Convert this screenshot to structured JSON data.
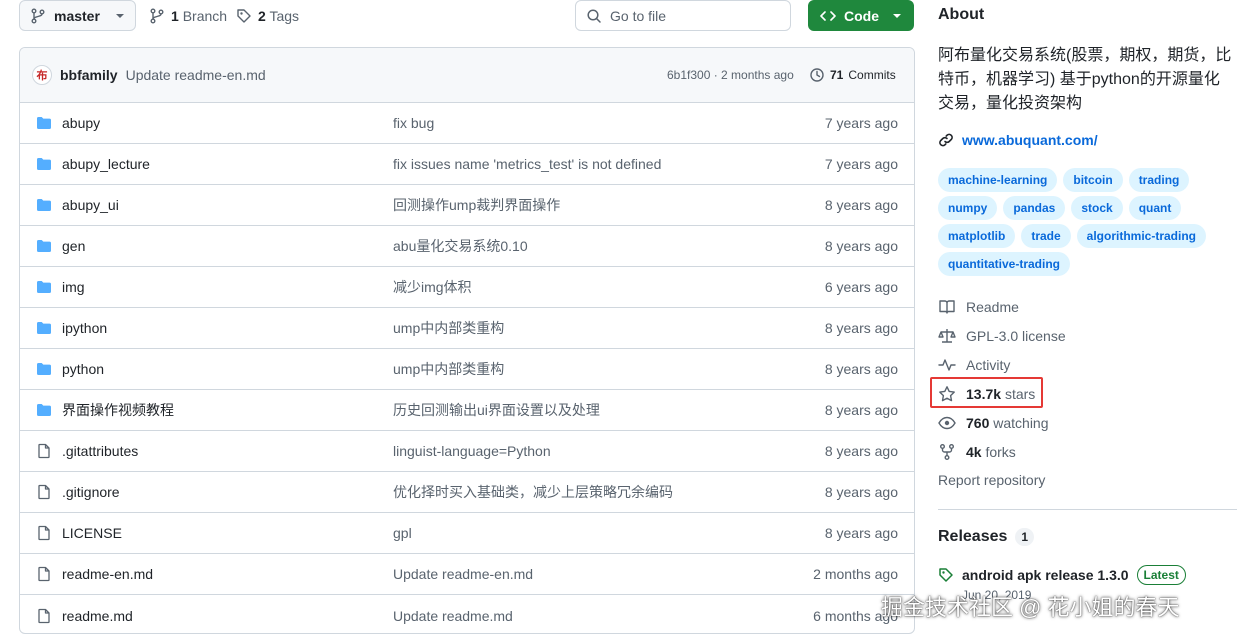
{
  "toolbar": {
    "branch": "master",
    "branches_count": "1",
    "branches_label": "Branch",
    "tags_count": "2",
    "tags_label": "Tags",
    "goto_placeholder": "Go to file",
    "code_label": "Code"
  },
  "latest_commit": {
    "avatar_text": "布",
    "author": "bbfamily",
    "message": "Update readme-en.md",
    "sha_time": "6b1f300 · 2 months ago",
    "commits_count": "71",
    "commits_label": "Commits"
  },
  "files": [
    {
      "type": "dir",
      "name": "abupy",
      "message": "fix bug",
      "date": "7 years ago"
    },
    {
      "type": "dir",
      "name": "abupy_lecture",
      "message": "fix issues name 'metrics_test' is not defined",
      "date": "7 years ago"
    },
    {
      "type": "dir",
      "name": "abupy_ui",
      "message": "回测操作ump裁判界面操作",
      "date": "8 years ago"
    },
    {
      "type": "dir",
      "name": "gen",
      "message": "abu量化交易系统0.10",
      "date": "8 years ago"
    },
    {
      "type": "dir",
      "name": "img",
      "message": "减少img体积",
      "date": "6 years ago"
    },
    {
      "type": "dir",
      "name": "ipython",
      "message": "ump中内部类重构",
      "date": "8 years ago"
    },
    {
      "type": "dir",
      "name": "python",
      "message": "ump中内部类重构",
      "date": "8 years ago"
    },
    {
      "type": "dir",
      "name": "界面操作视频教程",
      "message": "历史回测输出ui界面设置以及处理",
      "date": "8 years ago"
    },
    {
      "type": "file",
      "name": ".gitattributes",
      "message": "linguist-language=Python",
      "date": "8 years ago"
    },
    {
      "type": "file",
      "name": ".gitignore",
      "message": "优化择时买入基础类，减少上层策略冗余编码",
      "date": "8 years ago"
    },
    {
      "type": "file",
      "name": "LICENSE",
      "message": "gpl",
      "date": "8 years ago"
    },
    {
      "type": "file",
      "name": "readme-en.md",
      "message": "Update readme-en.md",
      "date": "2 months ago"
    },
    {
      "type": "file",
      "name": "readme.md",
      "message": "Update readme.md",
      "date": "6 months ago"
    }
  ],
  "about": {
    "title": "About",
    "description": "阿布量化交易系统(股票，期权，期货，比特币，机器学习) 基于python的开源量化交易，量化投资架构",
    "website": "www.abuquant.com/",
    "topics": [
      "machine-learning",
      "bitcoin",
      "trading",
      "numpy",
      "pandas",
      "stock",
      "quant",
      "matplotlib",
      "trade",
      "algorithmic-trading",
      "quantitative-trading"
    ],
    "readme": "Readme",
    "license": "GPL-3.0 license",
    "activity": "Activity",
    "stars_count": "13.7k",
    "stars_label": "stars",
    "watching_count": "760",
    "watching_label": "watching",
    "forks_count": "4k",
    "forks_label": "forks",
    "report": "Report repository"
  },
  "releases": {
    "title": "Releases",
    "count": "1",
    "latest_name": "android apk release 1.3.0",
    "latest_badge": "Latest",
    "latest_date": "Jun 20, 2019"
  },
  "watermark": "掘金技术社区 @ 花小姐的春天",
  "colors": {
    "accent": "#0969da",
    "code_button": "#1f883d",
    "folder": "#54aeff",
    "highlight_box": "#e53935"
  }
}
